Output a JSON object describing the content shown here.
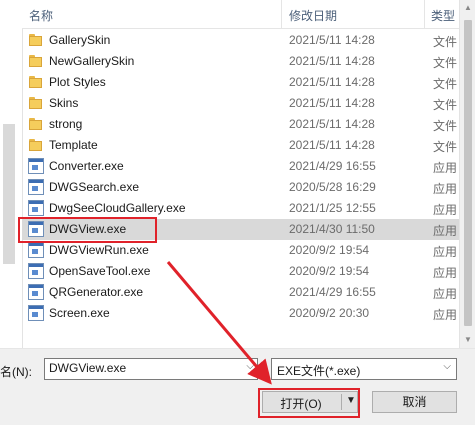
{
  "columns": {
    "name": "名称",
    "date": "修改日期",
    "type": "类型"
  },
  "files": [
    {
      "name": "GallerySkin",
      "date": "2021/5/11 14:28",
      "type": "文件",
      "icon": "folder-icon",
      "selected": false
    },
    {
      "name": "NewGallerySkin",
      "date": "2021/5/11 14:28",
      "type": "文件",
      "icon": "folder-icon",
      "selected": false
    },
    {
      "name": "Plot Styles",
      "date": "2021/5/11 14:28",
      "type": "文件",
      "icon": "folder-icon",
      "selected": false
    },
    {
      "name": "Skins",
      "date": "2021/5/11 14:28",
      "type": "文件",
      "icon": "folder-icon",
      "selected": false
    },
    {
      "name": "strong",
      "date": "2021/5/11 14:28",
      "type": "文件",
      "icon": "folder-icon",
      "selected": false
    },
    {
      "name": "Template",
      "date": "2021/5/11 14:28",
      "type": "文件",
      "icon": "folder-icon",
      "selected": false
    },
    {
      "name": "Converter.exe",
      "date": "2021/4/29 16:55",
      "type": "应用",
      "icon": "exe-icon",
      "selected": false
    },
    {
      "name": "DWGSearch.exe",
      "date": "2020/5/28 16:29",
      "type": "应用",
      "icon": "exe-icon",
      "selected": false
    },
    {
      "name": "DwgSeeCloudGallery.exe",
      "date": "2021/1/25 12:55",
      "type": "应用",
      "icon": "exe-icon",
      "selected": false
    },
    {
      "name": "DWGView.exe",
      "date": "2021/4/30 11:50",
      "type": "应用",
      "icon": "exe-icon",
      "selected": true
    },
    {
      "name": "DWGViewRun.exe",
      "date": "2020/9/2 19:54",
      "type": "应用",
      "icon": "exe-icon",
      "selected": false
    },
    {
      "name": "OpenSaveTool.exe",
      "date": "2020/9/2 19:54",
      "type": "应用",
      "icon": "exe-icon",
      "selected": false
    },
    {
      "name": "QRGenerator.exe",
      "date": "2021/4/29 16:55",
      "type": "应用",
      "icon": "exe-icon",
      "selected": false
    },
    {
      "name": "Screen.exe",
      "date": "2020/9/2 20:30",
      "type": "应用",
      "icon": "exe-icon",
      "selected": false
    }
  ],
  "filename": {
    "label": "名(N):",
    "value": "DWGView.exe"
  },
  "filetype": {
    "value": "EXE文件(*.exe)"
  },
  "buttons": {
    "open": "打开(O)",
    "cancel": "取消"
  },
  "colors": {
    "selection": "#d9d9d9",
    "annotation": "#e0222a"
  }
}
